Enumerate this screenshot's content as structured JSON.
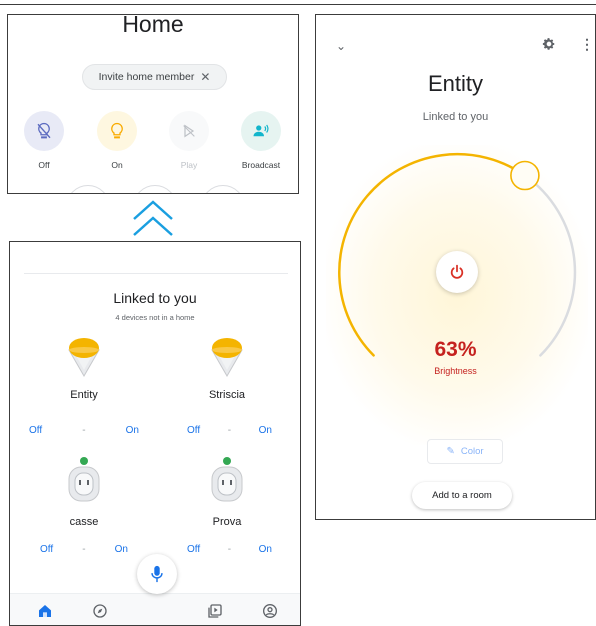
{
  "home": {
    "title": "Home",
    "invite_label": "Invite home member",
    "actions": [
      {
        "label": "Off",
        "icon": "lightbulb-off-icon",
        "bg": "#e8eaf6",
        "color": "#5c6bc0"
      },
      {
        "label": "On",
        "icon": "lightbulb-icon",
        "bg": "#fef7e0",
        "color": "#f9ab00"
      },
      {
        "label": "Play",
        "icon": "play-disabled-icon",
        "bg": "#f8f9fa",
        "color": "#bdc1c6"
      },
      {
        "label": "Broadcast",
        "icon": "broadcast-icon",
        "bg": "#e6f4f1",
        "color": "#12b5cb"
      }
    ]
  },
  "linked": {
    "title": "Linked to you",
    "subtitle": "4 devices not in a home",
    "devices": [
      {
        "name": "Entity",
        "type": "light",
        "off": "Off",
        "sep": "-",
        "on": "On"
      },
      {
        "name": "Striscia",
        "type": "light",
        "off": "Off",
        "sep": "-",
        "on": "On"
      },
      {
        "name": "casse",
        "type": "plug",
        "off": "Off",
        "sep": "-",
        "on": "On"
      },
      {
        "name": "Prova",
        "type": "plug",
        "off": "Off",
        "sep": "-",
        "on": "On"
      }
    ],
    "nav": [
      "home-icon",
      "compass-icon",
      "media-icon",
      "account-icon"
    ]
  },
  "entity": {
    "title": "Entity",
    "subtitle": "Linked to you",
    "brightness_pct": 63,
    "brightness_value": "63%",
    "brightness_label": "Brightness",
    "color_label": "Color",
    "add_room_label": "Add to a room"
  },
  "colors": {
    "accent_blue": "#1a73e8",
    "brightness_red": "#c5221f",
    "arc_yellow": "#f4b400",
    "arc_grey": "#dadce0"
  }
}
